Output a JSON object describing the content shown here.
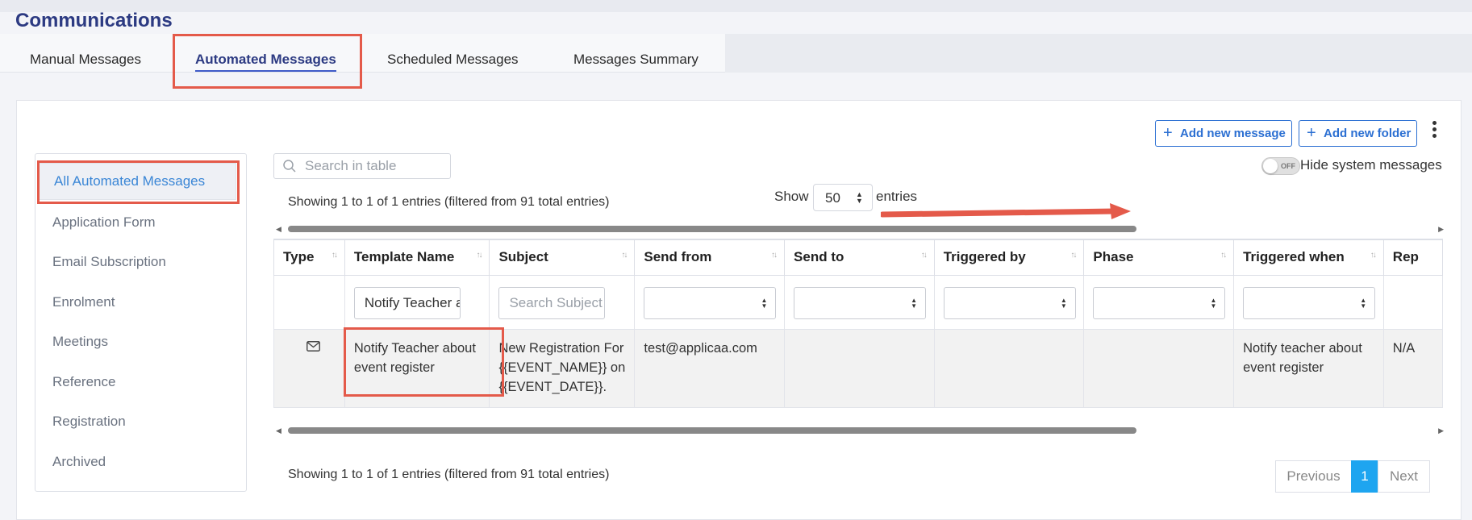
{
  "page": {
    "title": "Communications"
  },
  "tabs": [
    {
      "label": "Manual Messages"
    },
    {
      "label": "Automated Messages",
      "active": true
    },
    {
      "label": "Scheduled Messages"
    },
    {
      "label": "Messages Summary"
    }
  ],
  "sidebar": {
    "items": [
      {
        "label": "All Automated Messages",
        "active": true
      },
      {
        "label": "Application Form"
      },
      {
        "label": "Email Subscription"
      },
      {
        "label": "Enrolment"
      },
      {
        "label": "Meetings"
      },
      {
        "label": "Reference"
      },
      {
        "label": "Registration"
      },
      {
        "label": "Archived"
      }
    ]
  },
  "toolbar": {
    "add_message_label": "Add new message",
    "add_folder_label": "Add new folder",
    "search_placeholder": "Search in table",
    "toggle_state": "OFF",
    "toggle_label": "Hide system messages"
  },
  "table_info": {
    "top": "Showing 1 to 1 of 1 entries (filtered from 91 total entries)",
    "bottom": "Showing 1 to 1 of 1 entries (filtered from 91 total entries)",
    "show_label": "Show",
    "entries_value": "50",
    "entries_label": "entries"
  },
  "table": {
    "columns": [
      "Type",
      "Template Name",
      "Subject",
      "Send from",
      "Send to",
      "Triggered by",
      "Phase",
      "Triggered when",
      "Rep"
    ],
    "filters": {
      "template_name_value": "Notify Teacher abo",
      "subject_placeholder": "Search Subject"
    },
    "rows": [
      {
        "type_icon": "envelope-icon",
        "template_name": "Notify Teacher about event register",
        "subject": "New Registration For {{EVENT_NAME}} on {{EVENT_DATE}}.",
        "send_from": "test@applicaa.com",
        "send_to": "",
        "triggered_by": "",
        "phase": "",
        "triggered_when": "Notify teacher about event register",
        "rep": "N/A"
      }
    ]
  },
  "pagination": {
    "previous": "Previous",
    "current": "1",
    "next": "Next"
  },
  "colors": {
    "title": "#2c3a82",
    "primary": "#2b6fd2",
    "highlight": "#e45a4a",
    "page_active": "#1ea5f0"
  }
}
